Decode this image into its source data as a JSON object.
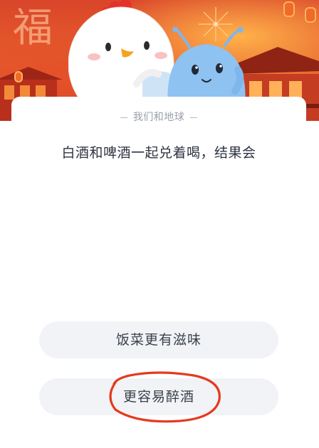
{
  "banner": {
    "decor_char": "福"
  },
  "quiz": {
    "category": "我们和地球",
    "question": "白酒和啤酒一起兑着喝，结果会",
    "options": [
      {
        "label": "饭菜更有滋味"
      },
      {
        "label": "更容易醉酒",
        "circled": true
      }
    ]
  },
  "colors": {
    "banner_red": "#d9452a",
    "option_bg": "#f1f3f6",
    "circle_mark": "#e53a1e",
    "question_text": "#2d3340",
    "category_text": "#9aa0a8"
  },
  "icons": [
    "chicken-mascot-icon",
    "alien-mascot-icon",
    "firework-icon",
    "lantern-icon"
  ]
}
